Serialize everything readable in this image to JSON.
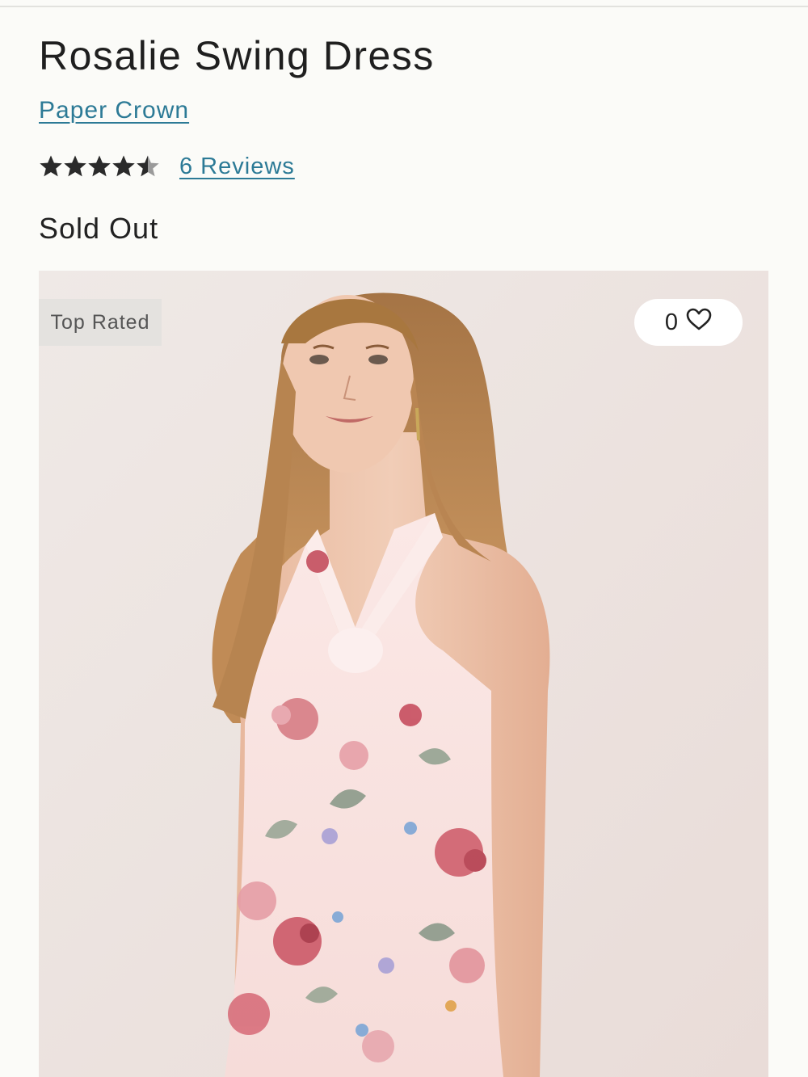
{
  "product": {
    "title": "Rosalie Swing Dress",
    "brand": "Paper Crown",
    "rating": 4.5,
    "rating_max": 5,
    "reviews_label": "6 Reviews",
    "status": "Sold Out"
  },
  "image": {
    "badge": "Top Rated",
    "favorites_count": "0",
    "favorite_icon": "heart-icon"
  },
  "colors": {
    "link": "#2c7a96",
    "star": "#2a2a2a",
    "background": "#fbfbf8"
  }
}
